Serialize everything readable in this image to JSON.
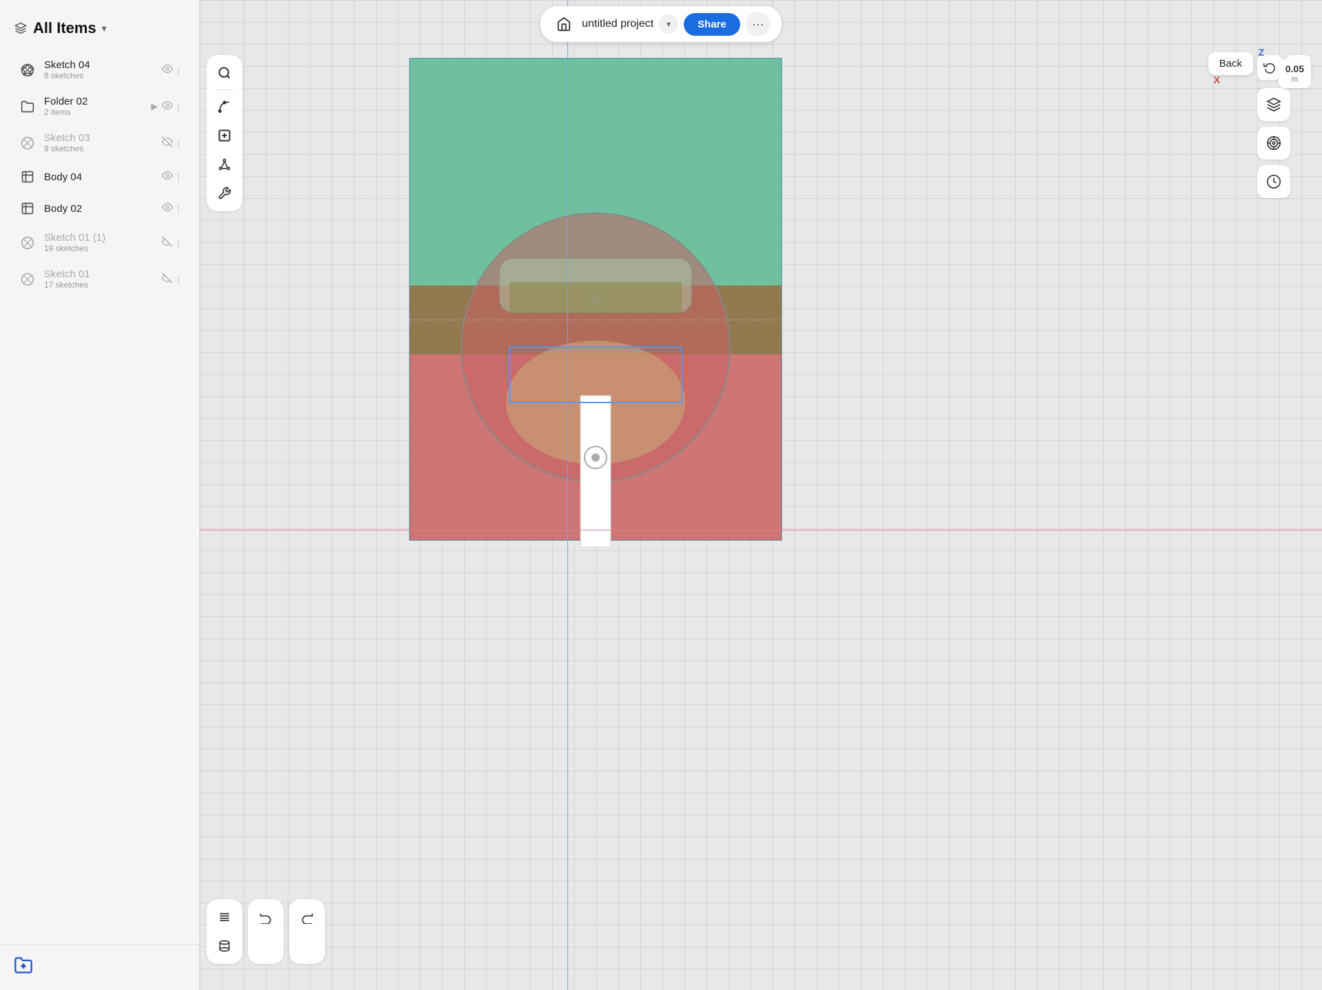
{
  "topbar": {
    "project_name": "untitled project",
    "share_label": "Share",
    "more_label": "···",
    "chevron": "▾",
    "home_icon": "🏠"
  },
  "sidebar": {
    "header": {
      "label": "All Items",
      "chevron": "▾",
      "icon": "⬡"
    },
    "items": [
      {
        "name": "Sketch 04",
        "sub": "8 sketches",
        "type": "sketch",
        "muted": false
      },
      {
        "name": "Folder 02",
        "sub": "2 items",
        "type": "folder",
        "muted": false
      },
      {
        "name": "Sketch 03",
        "sub": "9 sketches",
        "type": "sketch",
        "muted": true
      },
      {
        "name": "Body 04",
        "sub": "",
        "type": "body",
        "muted": false
      },
      {
        "name": "Body 02",
        "sub": "",
        "type": "body",
        "muted": false
      },
      {
        "name": "Sketch 01 (1)",
        "sub": "19 sketches",
        "type": "sketch",
        "muted": true
      },
      {
        "name": "Sketch 01",
        "sub": "17 sketches",
        "type": "sketch",
        "muted": true
      }
    ],
    "footer_icon": "📂"
  },
  "toolbar": {
    "top_section": [
      "🔍",
      "+",
      "✛",
      "⊕",
      "⚙"
    ],
    "bottom_section_left": [
      "↺"
    ],
    "bottom_section_right": [
      "↻"
    ]
  },
  "right_panel": {
    "back_label": "Back",
    "scale_value": "0.05",
    "scale_unit": "m",
    "axis_z": "Z",
    "axis_x": "X",
    "icons": [
      "🔷",
      "⭕",
      "🕐"
    ]
  },
  "canvas": {
    "bg_color": "#e8e8e8"
  }
}
